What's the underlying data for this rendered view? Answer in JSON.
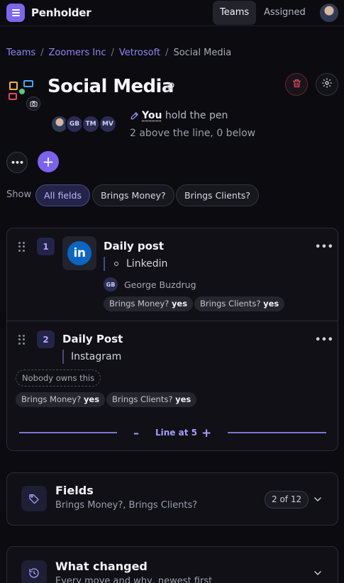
{
  "app": {
    "brand": "Penholder"
  },
  "nav": {
    "teams": "Teams",
    "assigned": "Assigned"
  },
  "breadcrumb": {
    "teams": "Teams",
    "org": "Zoomers Inc",
    "project": "Vetrosoft",
    "current": "Social Media",
    "separator": "/"
  },
  "page": {
    "title": "Social Media"
  },
  "members": [
    "GB",
    "TM",
    "MV"
  ],
  "pen": {
    "you": "You",
    "holds": "hold the pen",
    "line_summary": "2 above the line, 0 below"
  },
  "actions": {
    "more": "•••",
    "add": "+"
  },
  "filters": {
    "show_label": "Show",
    "all": "All fields",
    "money": "Brings Money?",
    "clients": "Brings Clients?"
  },
  "tasks": [
    {
      "index": "1",
      "title": "Daily post",
      "channel": "Linkedin",
      "owner_initials": "GB",
      "owner_name": "George Buzdrug",
      "tags": [
        {
          "label": "Brings Money?",
          "value": "yes"
        },
        {
          "label": "Brings Clients?",
          "value": "yes"
        }
      ]
    },
    {
      "index": "2",
      "title": "Daily Post",
      "channel": "Instagram",
      "owner_none": "Nobody owns this",
      "tags": [
        {
          "label": "Brings Money?",
          "value": "yes"
        },
        {
          "label": "Brings Clients?",
          "value": "yes"
        }
      ]
    }
  ],
  "line": {
    "label": "Line at 5",
    "minus": "–",
    "plus": "+"
  },
  "fields_panel": {
    "title": "Fields",
    "subtitle": "Brings Money?, Brings Clients?",
    "count": "2 of 12"
  },
  "changes_panel": {
    "title": "What changed",
    "subtitle": "Every move and why, newest first"
  },
  "colors": {
    "accent": "#7b63ef",
    "danger": "#e2485a",
    "linkedin": "#0a66c2"
  },
  "icons": [
    "menu-logo-icon",
    "user-avatar",
    "team-icon",
    "camera-icon",
    "link-icon",
    "trash-icon",
    "gear-icon",
    "pen-icon",
    "drag-handle-icon",
    "linkedin-icon",
    "tag-icon",
    "history-icon",
    "chevron-down-icon"
  ]
}
